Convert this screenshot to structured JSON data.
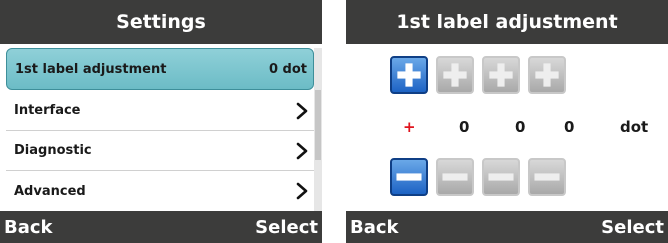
{
  "screen1": {
    "title": "Settings",
    "items": [
      {
        "label": "1st label adjustment",
        "value": "0 dot"
      },
      {
        "label": "Interface"
      },
      {
        "label": "Diagnostic"
      },
      {
        "label": "Advanced"
      }
    ],
    "back_label": "Back",
    "select_label": "Select"
  },
  "screen2": {
    "title": "1st label adjustment",
    "sign": "+",
    "digits": [
      "0",
      "0",
      "0"
    ],
    "unit": "dot",
    "back_label": "Back",
    "select_label": "Select"
  },
  "colors": {
    "bar_bg": "#3c3c3b",
    "selected_item": "#7cc6cf",
    "active_button": "#1d63c4",
    "inactive_button": "#bcbcbc",
    "sign_color": "#e0141e"
  },
  "icons": [
    "chevron-right-icon",
    "plus-icon",
    "minus-icon"
  ]
}
